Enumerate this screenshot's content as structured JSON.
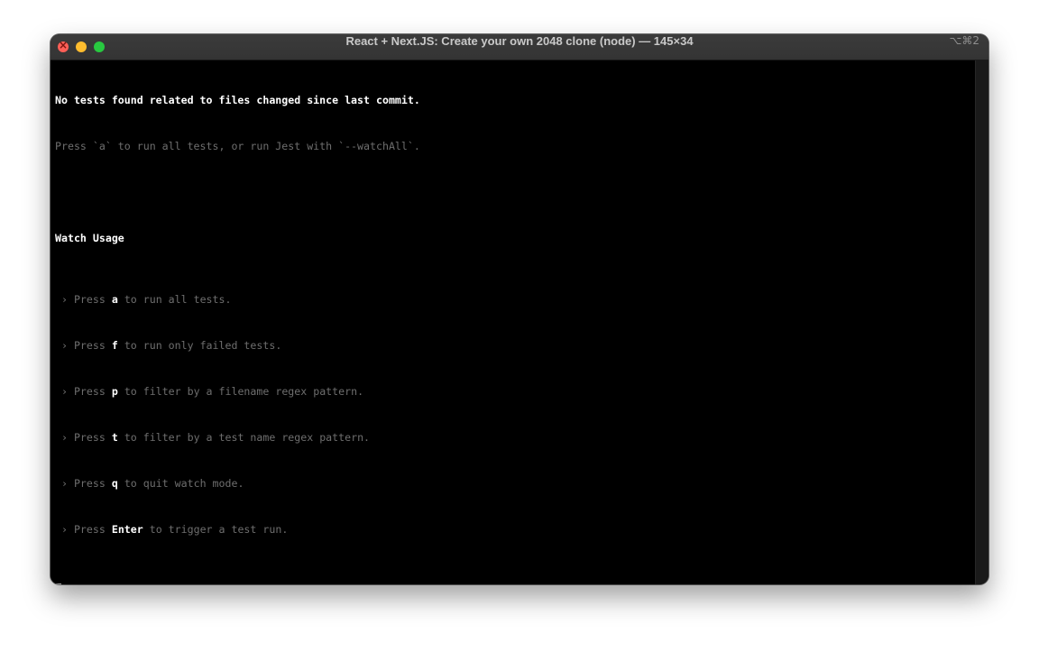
{
  "window": {
    "title": "React + Next.JS: Create your own 2048 clone (node) — 145×34",
    "shortcut": "⌥⌘2"
  },
  "terminal": {
    "line1": "No tests found related to files changed since last commit.",
    "line2": "Press `a` to run all tests, or run Jest with `--watchAll`.",
    "usage_heading": "Watch Usage",
    "prompt_char": "›",
    "press_word": "Press",
    "items": [
      {
        "key": "a",
        "desc": "to run all tests."
      },
      {
        "key": "f",
        "desc": "to run only failed tests."
      },
      {
        "key": "p",
        "desc": "to filter by a filename regex pattern."
      },
      {
        "key": "t",
        "desc": "to filter by a test name regex pattern."
      },
      {
        "key": "q",
        "desc": "to quit watch mode."
      },
      {
        "key": "Enter",
        "desc": "to trigger a test run."
      }
    ]
  },
  "colors": {
    "close": "#ff5f57",
    "minimize": "#febc2e",
    "maximize": "#28c840",
    "terminal_bg": "#000000",
    "dim_text": "#6e6e6e"
  }
}
